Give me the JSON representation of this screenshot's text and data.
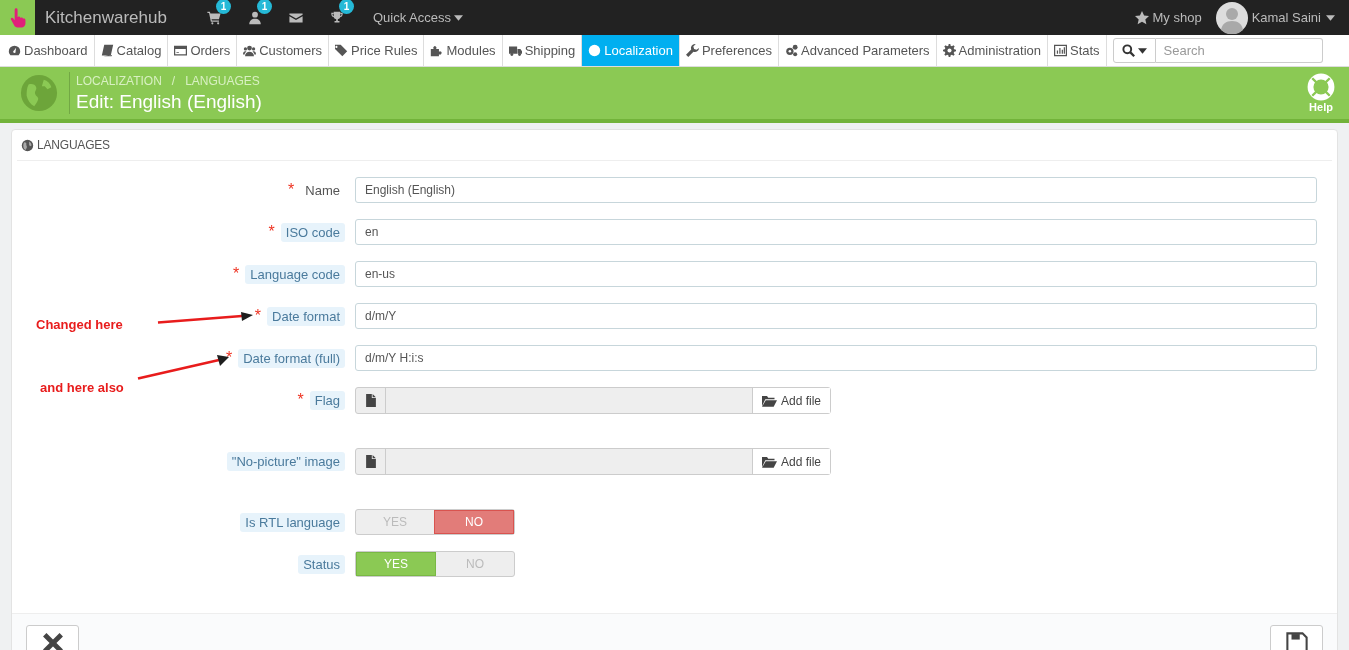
{
  "topbar": {
    "brand": "Kitchenwarehub",
    "notifications": [
      {
        "kind": "cart",
        "badge": "1"
      },
      {
        "kind": "user",
        "badge": "1"
      },
      {
        "kind": "mail"
      },
      {
        "kind": "trophy",
        "badge": "1"
      }
    ],
    "quick_access": "Quick Access",
    "shop_link": "My shop",
    "user": "Kamal Saini"
  },
  "menu": [
    {
      "label": "Dashboard",
      "selected": false
    },
    {
      "label": "Catalog",
      "selected": false
    },
    {
      "label": "Orders",
      "selected": false
    },
    {
      "label": "Customers",
      "selected": false
    },
    {
      "label": "Price Rules",
      "selected": false
    },
    {
      "label": "Modules",
      "selected": false
    },
    {
      "label": "Shipping",
      "selected": false
    },
    {
      "label": "Localization",
      "selected": true
    },
    {
      "label": "Preferences",
      "selected": false
    },
    {
      "label": "Advanced Parameters",
      "selected": false
    },
    {
      "label": "Administration",
      "selected": false
    },
    {
      "label": "Stats",
      "selected": false
    }
  ],
  "search": {
    "placeholder": "Search"
  },
  "header": {
    "breadcrumb": [
      "LOCALIZATION",
      "LANGUAGES"
    ],
    "breadcrumb_separator": "/",
    "title": "Edit: English (English)",
    "help": "Help"
  },
  "panel": {
    "heading": "LANGUAGES",
    "fields": [
      {
        "kind": "text",
        "label": "Name",
        "required_mark": "*",
        "has_help": false,
        "value": "English (English)"
      },
      {
        "kind": "text",
        "label": "ISO code",
        "required_mark": "*",
        "has_help": true,
        "value": "en"
      },
      {
        "kind": "text",
        "label": "Language code",
        "required_mark": "*",
        "has_help": true,
        "value": "en-us"
      },
      {
        "kind": "text",
        "label": "Date format",
        "required_mark": "*",
        "has_help": true,
        "value": "d/m/Y",
        "annotation": "Changed here"
      },
      {
        "kind": "text",
        "label": "Date format (full)",
        "required_mark": "*",
        "has_help": true,
        "value": "d/m/Y H:i:s",
        "annotation": "and here also"
      },
      {
        "kind": "file",
        "label": "Flag",
        "required_mark": "*",
        "has_help": true,
        "button": "Add file"
      },
      {
        "kind": "file",
        "label": "\"No-picture\" image",
        "has_help": true,
        "button": "Add file"
      },
      {
        "kind": "switch",
        "label": "Is RTL language",
        "has_help": true,
        "options": [
          {
            "label": "YES",
            "selected": false
          },
          {
            "label": "NO",
            "selected": true
          }
        ]
      },
      {
        "kind": "switch",
        "label": "Status",
        "has_help": true,
        "options": [
          {
            "label": "YES",
            "selected": true
          },
          {
            "label": "NO",
            "selected": false
          }
        ]
      }
    ]
  }
}
